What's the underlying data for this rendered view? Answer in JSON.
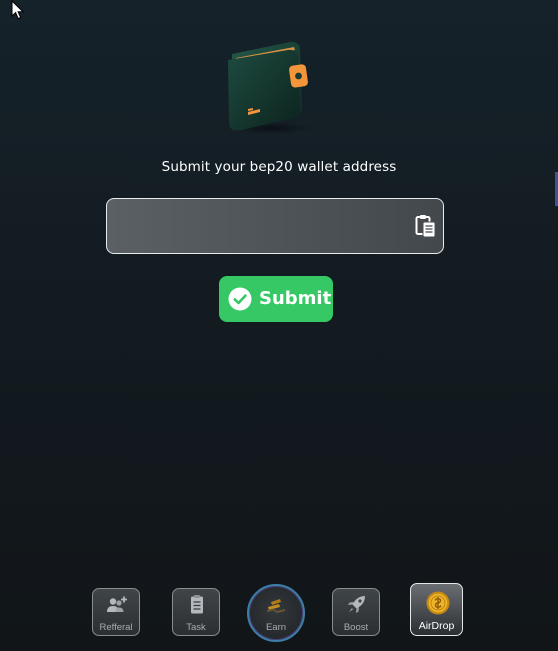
{
  "prompt_text": "Submit your bep20 wallet address",
  "address_input": {
    "value": "",
    "placeholder": ""
  },
  "submit_label": "Submit",
  "nav": {
    "referral": {
      "label": "Refferal",
      "icon": "add-user-icon"
    },
    "task": {
      "label": "Task",
      "icon": "clipboard-icon"
    },
    "earn": {
      "label": "Earn",
      "icon": "gold-bars-icon"
    },
    "boost": {
      "label": "Boost",
      "icon": "rocket-icon"
    },
    "airdrop": {
      "label": "AirDrop",
      "icon": "coin-icon"
    }
  },
  "colors": {
    "accent_green": "#35c864",
    "wallet_orange": "#f3953a",
    "wallet_green": "#173a31",
    "coin_gold": "#e3a91a"
  }
}
